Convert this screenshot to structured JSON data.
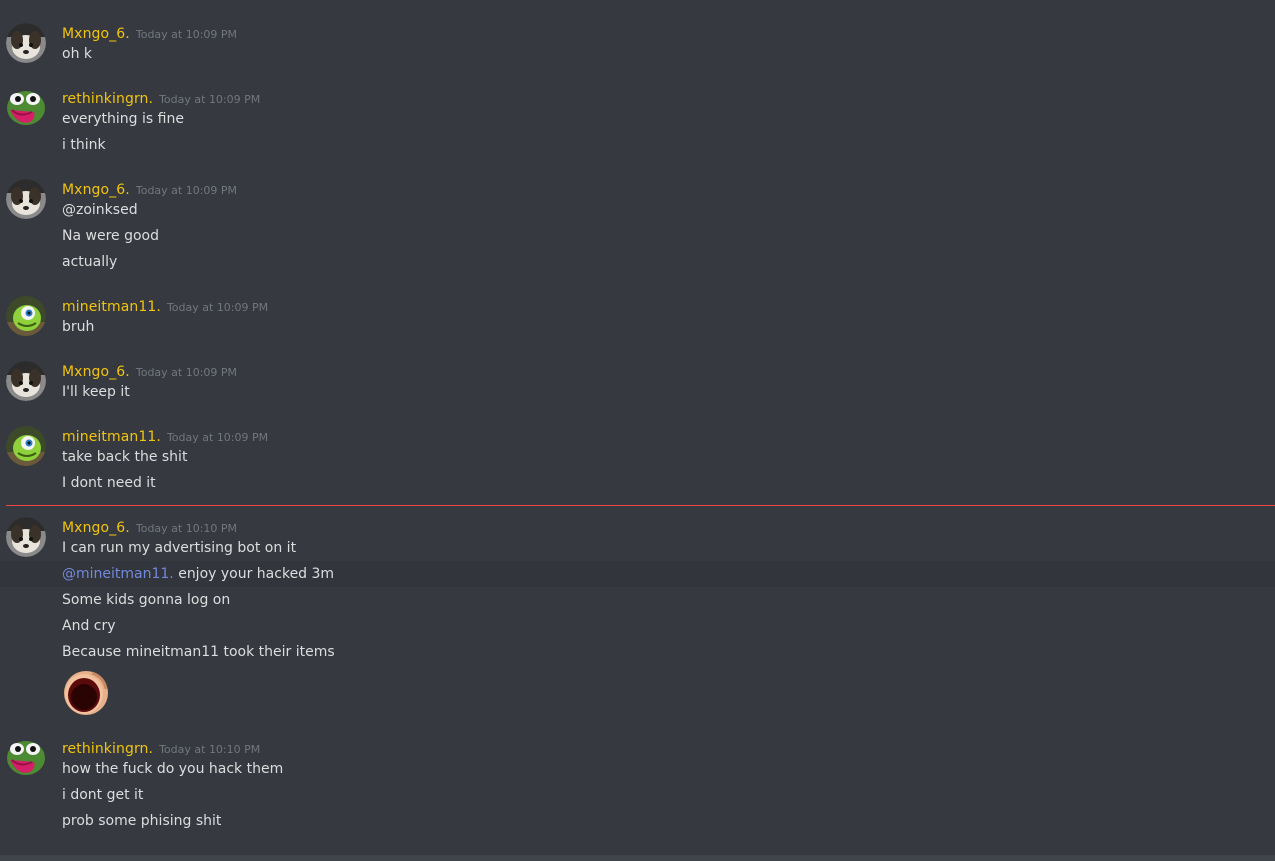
{
  "messages": [
    {
      "username": "Mxngo_6.",
      "timestamp": "Today at 10:09 PM",
      "avatar_icon": "dog-avatar-icon",
      "lines": [
        "oh k"
      ]
    },
    {
      "username": "rethinkingrn.",
      "timestamp": "Today at 10:09 PM",
      "avatar_icon": "pepe-frog-avatar-icon",
      "lines": [
        "everything is fine",
        "i think"
      ]
    },
    {
      "username": "Mxngo_6.",
      "timestamp": "Today at 10:09 PM",
      "avatar_icon": "dog-avatar-icon",
      "lines": [
        "@zoinksed",
        "Na were good",
        "actually"
      ]
    },
    {
      "username": "mineitman11.",
      "timestamp": "Today at 10:09 PM",
      "avatar_icon": "green-monster-avatar-icon",
      "lines": [
        "bruh"
      ]
    },
    {
      "username": "Mxngo_6.",
      "timestamp": "Today at 10:09 PM",
      "avatar_icon": "dog-avatar-icon",
      "lines": [
        "I'll keep it"
      ]
    },
    {
      "username": "mineitman11.",
      "timestamp": "Today at 10:09 PM",
      "avatar_icon": "green-monster-avatar-icon",
      "lines": [
        "take back the shit",
        "I dont need it"
      ]
    },
    {
      "username": "Mxngo_6.",
      "timestamp": "Today at 10:10 PM",
      "avatar_icon": "dog-avatar-icon",
      "lines": [
        "I can run my advertising bot on it",
        {
          "mention": "@mineitman11.",
          "text": " enjoy your hacked 3m"
        },
        "Some kids gonna log on",
        "And cry",
        "Because mineitman11 took their items"
      ],
      "emoji_icon": "screaming-face-emoji-icon"
    },
    {
      "username": "rethinkingrn.",
      "timestamp": "Today at 10:10 PM",
      "avatar_icon": "pepe-frog-avatar-icon",
      "lines": [
        "how the fuck do you hack them",
        "i dont get it",
        "prob some phising shit"
      ]
    }
  ],
  "new_messages_divider_color": "#f04747",
  "colors": {
    "background": "#36393f",
    "username": "#f1c40f",
    "text": "#dcddde",
    "timestamp": "#72767d",
    "mention": "#7289da"
  }
}
